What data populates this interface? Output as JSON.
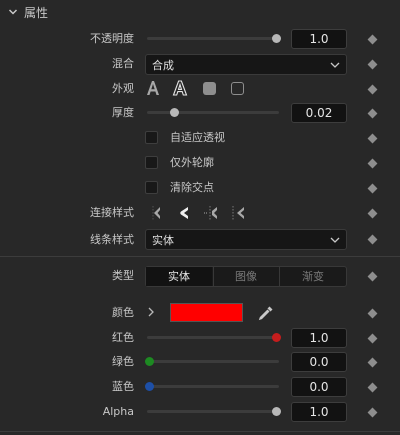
{
  "section": {
    "title": "属性"
  },
  "opacity": {
    "label": "不透明度",
    "value": "1.0",
    "level": 1.0
  },
  "blend": {
    "label": "混合",
    "value": "合成"
  },
  "appearance": {
    "label": "外观"
  },
  "thickness": {
    "label": "厚度",
    "value": "0.02",
    "level": 0.02
  },
  "checkboxes": [
    {
      "label": "自适应透视",
      "checked": false
    },
    {
      "label": "仅外轮廓",
      "checked": false
    },
    {
      "label": "清除交点",
      "checked": false
    }
  ],
  "join_style": {
    "label": "连接样式"
  },
  "line_style": {
    "label": "线条样式",
    "value": "实体"
  },
  "type": {
    "label": "类型",
    "options": [
      "实体",
      "图像",
      "渐变"
    ],
    "selected": "实体"
  },
  "color": {
    "label": "颜色",
    "swatch": "#ff0000"
  },
  "red": {
    "label": "红色",
    "value": "1.0",
    "level": 1.0
  },
  "green": {
    "label": "绿色",
    "value": "0.0",
    "level": 0.0
  },
  "blue": {
    "label": "蓝色",
    "value": "0.0",
    "level": 0.0
  },
  "alpha": {
    "label": "Alpha",
    "value": "1.0",
    "level": 1.0
  }
}
